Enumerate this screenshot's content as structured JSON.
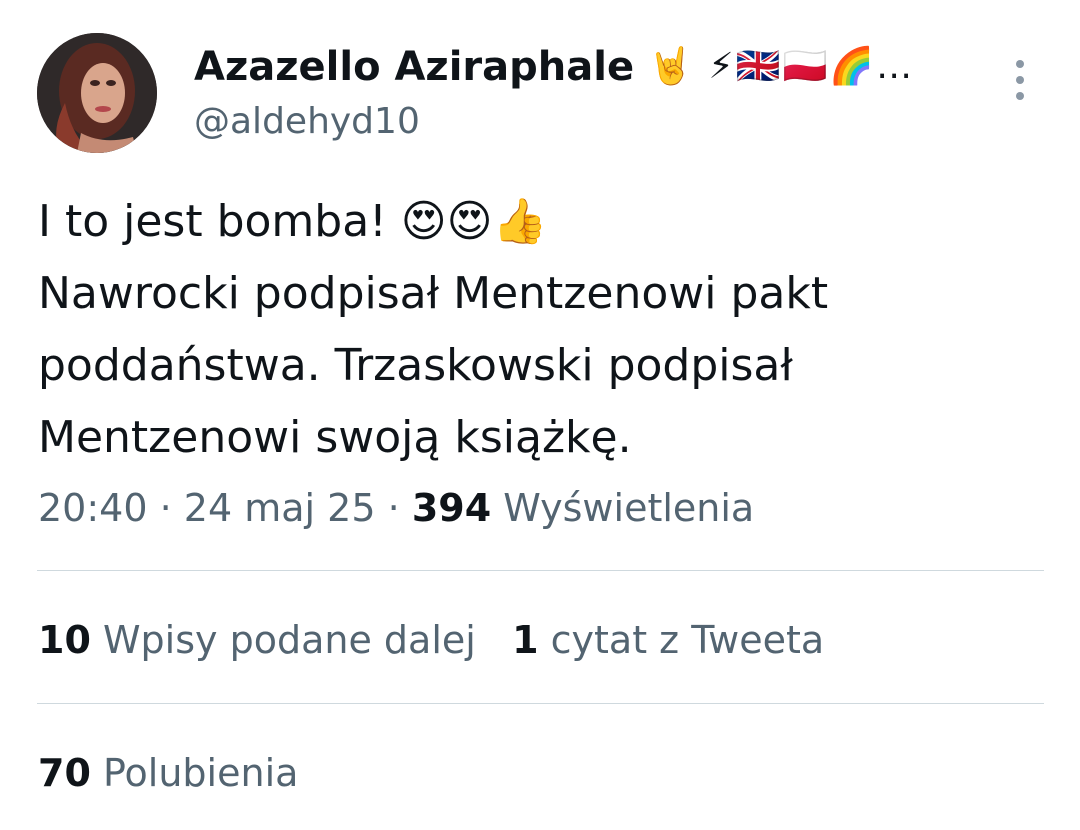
{
  "author": {
    "display_name": "Azazello Aziraphale",
    "name_emojis": "🤘 ⚡🇬🇧🇵🇱🌈…",
    "handle": "@aldehyd10",
    "avatar_icon": "profile-photo"
  },
  "tweet": {
    "lines": [
      "I to jest bomba! 😍😍👍",
      "Nawrocki podpisał Mentzenowi pakt",
      "poddaństwa. Trzaskowski podpisał",
      "Mentzenowi swoją książkę."
    ]
  },
  "meta": {
    "time": "20:40",
    "separator": "·",
    "date": "24 maj 25",
    "views_count": "394",
    "views_label": "Wyświetlenia"
  },
  "stats": {
    "retweets_count": "10",
    "retweets_label": "Wpisy podane dalej",
    "quotes_count": "1",
    "quotes_label": "cytat z Tweeta",
    "likes_count": "70",
    "likes_label": "Polubienia"
  },
  "colors": {
    "text_primary": "#0f1419",
    "text_secondary": "#536471",
    "divider": "#cfd9de",
    "background": "#ffffff"
  }
}
